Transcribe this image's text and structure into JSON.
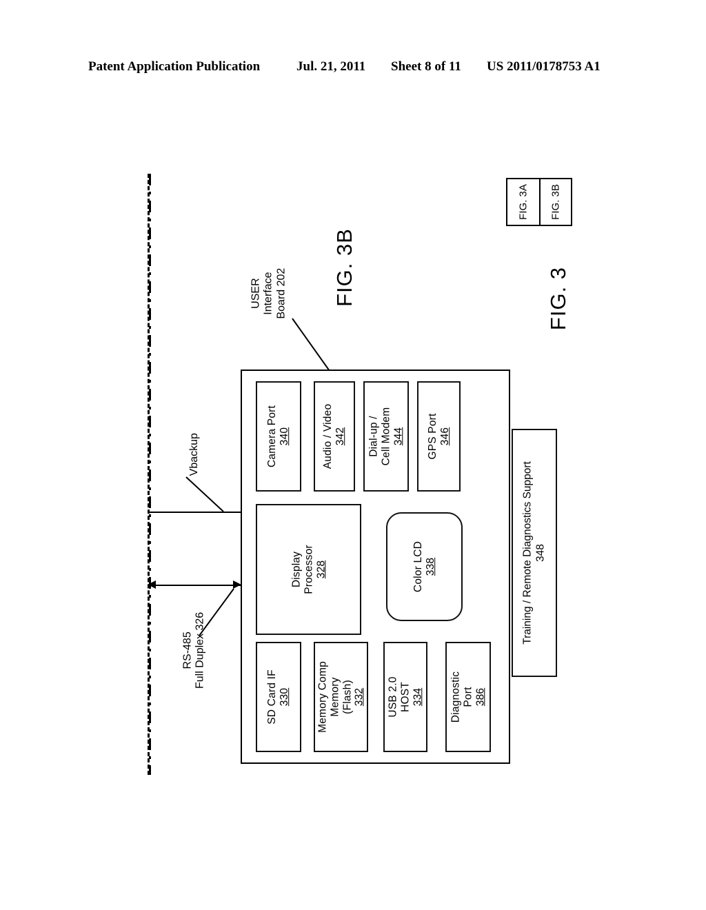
{
  "header": {
    "publication": "Patent Application Publication",
    "date": "Jul. 21, 2011",
    "sheet": "Sheet 8 of 11",
    "patent_number": "US 2011/0178753 A1"
  },
  "figure": {
    "title": "FIG. 3B",
    "key_title": "FIG. 3",
    "key_cells": [
      "FIG. 3A",
      "FIG. 3B"
    ],
    "board_callout": {
      "line1": "USER",
      "line2": "Interface",
      "line3": "Board",
      "number": "202"
    },
    "signals": [
      {
        "name": "Vbackup",
        "number": ""
      },
      {
        "name_line1": "RS-485",
        "name_line2": "Full Duplex",
        "number": "326"
      }
    ],
    "vbackup_label": "Vbackup",
    "rs485_line1": "RS-485",
    "rs485_line2": "Full Duplex",
    "rs485_number": "326",
    "components": {
      "camera_port": {
        "line1": "Camera Port",
        "number": "340"
      },
      "audio_video": {
        "line1": "Audio / Video",
        "number": "342"
      },
      "cell_modem": {
        "line1": "Dial-up /",
        "line2": "Cell Modem",
        "number": "344"
      },
      "gps_port": {
        "line1": "GPS Port",
        "number": "346"
      },
      "display_processor": {
        "line1": "Display",
        "line2": "Processor",
        "number": "328"
      },
      "color_lcd": {
        "line1": "Color LCD",
        "number": "338"
      },
      "sd_card_if": {
        "line1": "SD Card IF",
        "number": "330"
      },
      "memory_flash": {
        "line1": "Memory Comp",
        "line2": "Memory",
        "line3": "(Flash)",
        "number": "332"
      },
      "usb_host": {
        "line1": "USB 2.0",
        "line2": "HOST",
        "number": "334"
      },
      "diagnostic_port": {
        "line1": "Diagnostic",
        "line2": "Port",
        "number": "386"
      },
      "training_support": {
        "line1": "Training / Remote Diagnostics Support",
        "number": "348"
      }
    }
  }
}
